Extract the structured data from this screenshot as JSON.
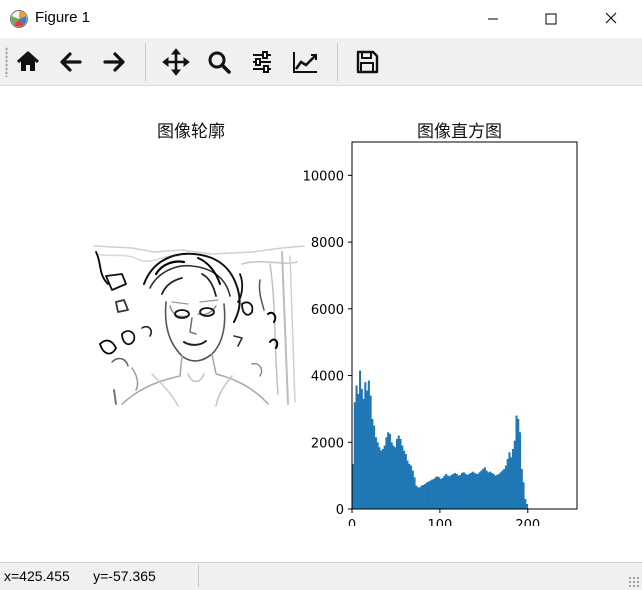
{
  "window": {
    "title": "Figure 1",
    "controls": [
      "minimize",
      "maximize",
      "close"
    ]
  },
  "toolbar": {
    "buttons": [
      {
        "name": "home",
        "icon": "home-icon"
      },
      {
        "name": "back",
        "icon": "arrow-left-icon"
      },
      {
        "name": "forward",
        "icon": "arrow-right-icon"
      },
      {
        "name": "pan",
        "icon": "move-icon"
      },
      {
        "name": "zoom",
        "icon": "magnifier-icon"
      },
      {
        "name": "configure-subplots",
        "icon": "sliders-icon"
      },
      {
        "name": "edit-axis",
        "icon": "line-chart-icon"
      },
      {
        "name": "save",
        "icon": "floppy-disk-icon"
      }
    ]
  },
  "figure": {
    "left_title": "图像轮廓",
    "right_title": "图像直方图"
  },
  "chart_data": {
    "type": "bar",
    "title": "图像直方图",
    "xlabel": "",
    "ylabel": "",
    "xlim": [
      0,
      256
    ],
    "ylim": [
      0,
      11000
    ],
    "xticks": [
      0,
      100,
      200
    ],
    "yticks": [
      0,
      2000,
      4000,
      6000,
      8000,
      10000
    ],
    "xtick_labels": [
      "0",
      "100",
      "200"
    ],
    "ytick_labels": [
      "0",
      "2000",
      "4000",
      "6000",
      "8000",
      "10000"
    ],
    "bar_color": "#1f77b4",
    "bin_width": 2,
    "bin_starts": [
      0,
      2,
      4,
      6,
      8,
      10,
      12,
      14,
      16,
      18,
      20,
      22,
      24,
      26,
      28,
      30,
      32,
      34,
      36,
      38,
      40,
      42,
      44,
      46,
      48,
      50,
      52,
      54,
      56,
      58,
      60,
      62,
      64,
      66,
      68,
      70,
      72,
      74,
      76,
      78,
      80,
      82,
      84,
      86,
      88,
      90,
      92,
      94,
      96,
      98,
      100,
      102,
      104,
      106,
      108,
      110,
      112,
      114,
      116,
      118,
      120,
      122,
      124,
      126,
      128,
      130,
      132,
      134,
      136,
      138,
      140,
      142,
      144,
      146,
      148,
      150,
      152,
      154,
      156,
      158,
      160,
      162,
      164,
      166,
      168,
      170,
      172,
      174,
      176,
      178,
      180,
      182,
      184,
      186,
      188,
      190,
      192,
      194,
      196,
      198,
      200,
      202,
      204,
      206,
      208,
      210,
      212,
      214,
      216,
      218,
      220,
      222,
      224,
      226,
      228,
      230,
      232,
      234,
      236,
      238,
      240,
      242,
      244,
      246,
      248,
      250,
      252,
      254
    ],
    "counts": [
      1350,
      3200,
      3700,
      3450,
      4150,
      3600,
      3300,
      3800,
      3550,
      3850,
      3400,
      2700,
      2500,
      2150,
      2000,
      1850,
      1750,
      1800,
      1900,
      2150,
      2300,
      2250,
      2000,
      1900,
      1850,
      2100,
      2200,
      2100,
      1900,
      1750,
      1650,
      1450,
      1350,
      1300,
      1150,
      950,
      700,
      650,
      650,
      700,
      720,
      750,
      800,
      820,
      850,
      880,
      900,
      950,
      980,
      950,
      900,
      930,
      1000,
      1050,
      1000,
      980,
      1020,
      1050,
      1080,
      1050,
      1000,
      1020,
      1080,
      1100,
      1060,
      1020,
      1050,
      1080,
      1120,
      1090,
      1060,
      1050,
      1100,
      1150,
      1200,
      1250,
      1150,
      1100,
      1120,
      1080,
      1050,
      1000,
      1020,
      1050,
      1100,
      1150,
      1200,
      1300,
      1500,
      1700,
      1550,
      1800,
      2050,
      2800,
      2700,
      2300,
      1200,
      800,
      300,
      150
    ]
  }
}
